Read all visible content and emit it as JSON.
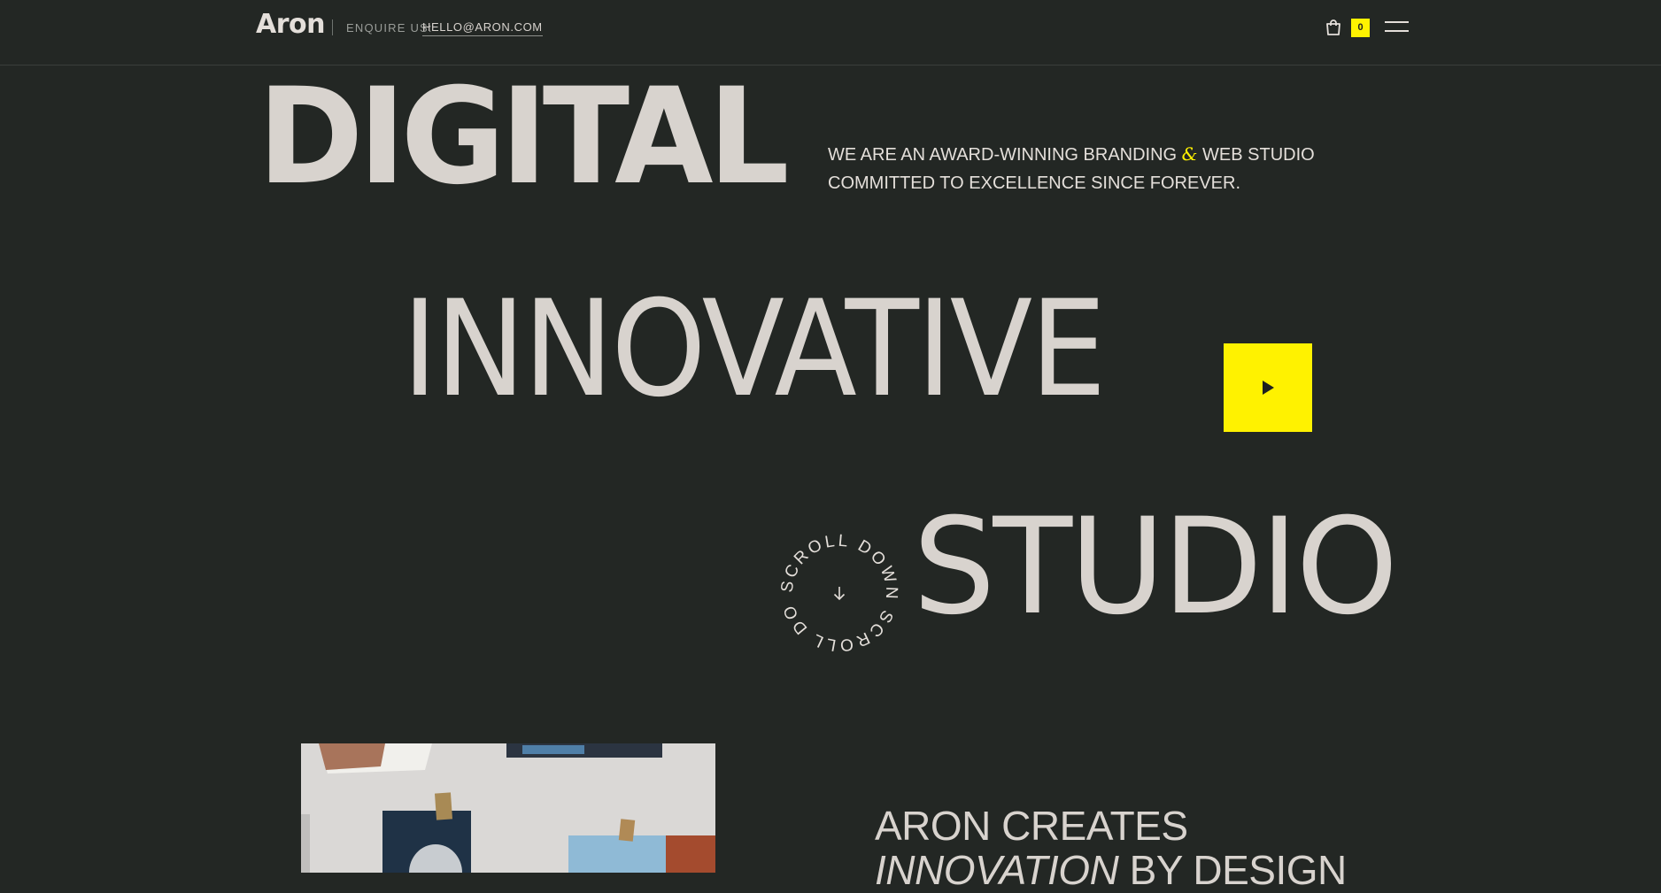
{
  "header": {
    "logo": "Aron",
    "enquire_label": "ENQUIRE US:",
    "email": "HELLO@ARON.COM",
    "cart_count": "0",
    "accent_color": "#fff200"
  },
  "hero": {
    "word_1": "DIGITAL",
    "word_2": "INNOVATIVE",
    "word_3": "STUDIO",
    "tagline_part_1": "WE ARE AN AWARD-WINNING BRANDING ",
    "tagline_amp": "&",
    "tagline_part_2": " WEB STUDIO COMMITTED TO EXCELLENCE SINCE FOREVER.",
    "scroll_text": "SCROLL DOWN SCROLL DOWN "
  },
  "about": {
    "heading_line_1": "ARON CREATES",
    "heading_italic": "INNOVATION",
    "heading_rest": " BY DESIGN"
  },
  "icons": {
    "cart": "shopping-bag-icon",
    "menu": "hamburger-menu-icon",
    "play": "play-icon",
    "scroll": "arrow-down-icon"
  }
}
